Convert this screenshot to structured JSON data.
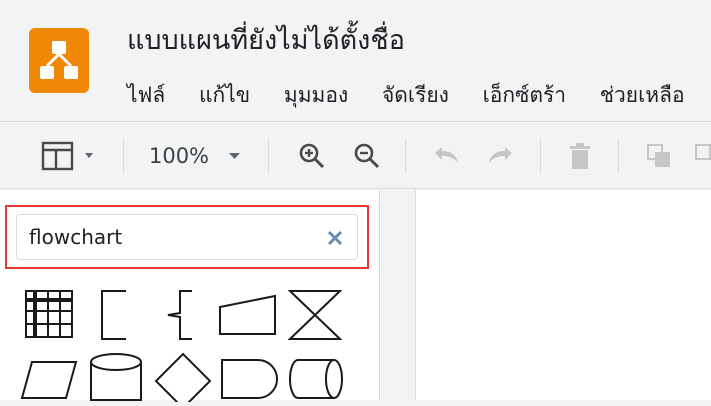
{
  "app": {
    "title": "แบบแผนที่ยังไม่ได้ตั้งชื่อ",
    "logo_icon": "drawio-logo-icon",
    "accent_color": "#f08705"
  },
  "menu": [
    {
      "label": "ไฟล์"
    },
    {
      "label": "แก้ไข"
    },
    {
      "label": "มุมมอง"
    },
    {
      "label": "จัดเรียง"
    },
    {
      "label": "เอ็กซ์ตร้า"
    },
    {
      "label": "ช่วยเหลือ"
    }
  ],
  "toolbar": {
    "format_panel_icon": "format-panel-icon",
    "zoom_value": "100%",
    "zoom_in_icon": "zoom-in-icon",
    "zoom_out_icon": "zoom-out-icon",
    "undo_icon": "undo-icon",
    "redo_icon": "redo-icon",
    "delete_icon": "trash-icon",
    "to_front_icon": "to-front-icon",
    "to_back_icon": "to-back-icon"
  },
  "sidebar": {
    "search": {
      "value": "flowchart",
      "clear_icon": "close-icon",
      "highlight_color": "#e53935"
    },
    "shapes": [
      "internal-storage-shape",
      "annotation-bracket-shape",
      "annotation-curly-shape",
      "manual-input-shape",
      "collate-shape",
      "data-parallelogram-shape",
      "database-cylinder-shape",
      "decision-diamond-shape",
      "delay-shape",
      "direct-access-storage-shape"
    ]
  }
}
